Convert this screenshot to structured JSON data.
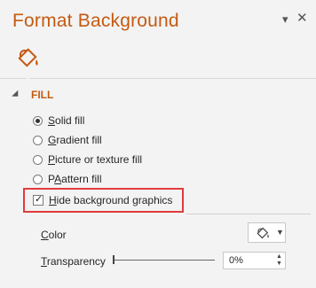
{
  "pane": {
    "title": "Format Background",
    "dropdown_glyph": "▾",
    "close_glyph": "✕"
  },
  "tabs": [
    {
      "icon": "fill-bucket-icon"
    }
  ],
  "fill_section": {
    "title": "FILL",
    "options": [
      {
        "key": "S",
        "rest": "olid fill",
        "selected": true
      },
      {
        "key": "G",
        "rest": "radient fill",
        "selected": false
      },
      {
        "key": "P",
        "rest": "icture or texture fill",
        "selected": false
      },
      {
        "key": "A",
        "rest": "attern fill",
        "selected_prefix": "P",
        "selected": false
      }
    ],
    "hide_graphics": {
      "key": "H",
      "rest": "ide background graphics",
      "checked": true
    }
  },
  "color": {
    "key": "C",
    "rest": "olor"
  },
  "transparency": {
    "key": "T",
    "rest": "ransparency",
    "value": "0%"
  }
}
